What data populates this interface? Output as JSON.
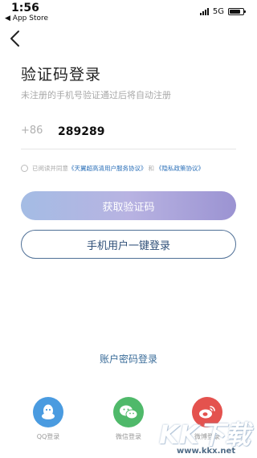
{
  "status_bar": {
    "time": "1:56",
    "back_label": "◀ App Store",
    "network": "5G"
  },
  "page": {
    "title": "验证码登录",
    "subtitle": "未注册的手机号验证通过后将自动注册"
  },
  "phone": {
    "country_code": "+86",
    "value": "289289"
  },
  "agreement": {
    "prefix": "已阅读并同意",
    "link1": "《天翼超高清用户服务协议》",
    "and": "和",
    "link2": "《隐私政策协议》"
  },
  "buttons": {
    "get_code": "获取验证码",
    "one_key_login": "手机用户一键登录",
    "password_login": "账户密码登录"
  },
  "social": [
    {
      "label": "QQ登录",
      "icon": "qq-icon"
    },
    {
      "label": "微信登录",
      "icon": "wechat-icon"
    },
    {
      "label": "微博登录",
      "icon": "weibo-icon"
    }
  ],
  "watermark": {
    "text": "KK下载",
    "url": "www.kkx.net"
  },
  "colors": {
    "link": "#2a6fb8",
    "qq": "#4a9be0",
    "wechat": "#4fb96a",
    "weibo": "#e4524e",
    "outline": "#4e6f96"
  }
}
